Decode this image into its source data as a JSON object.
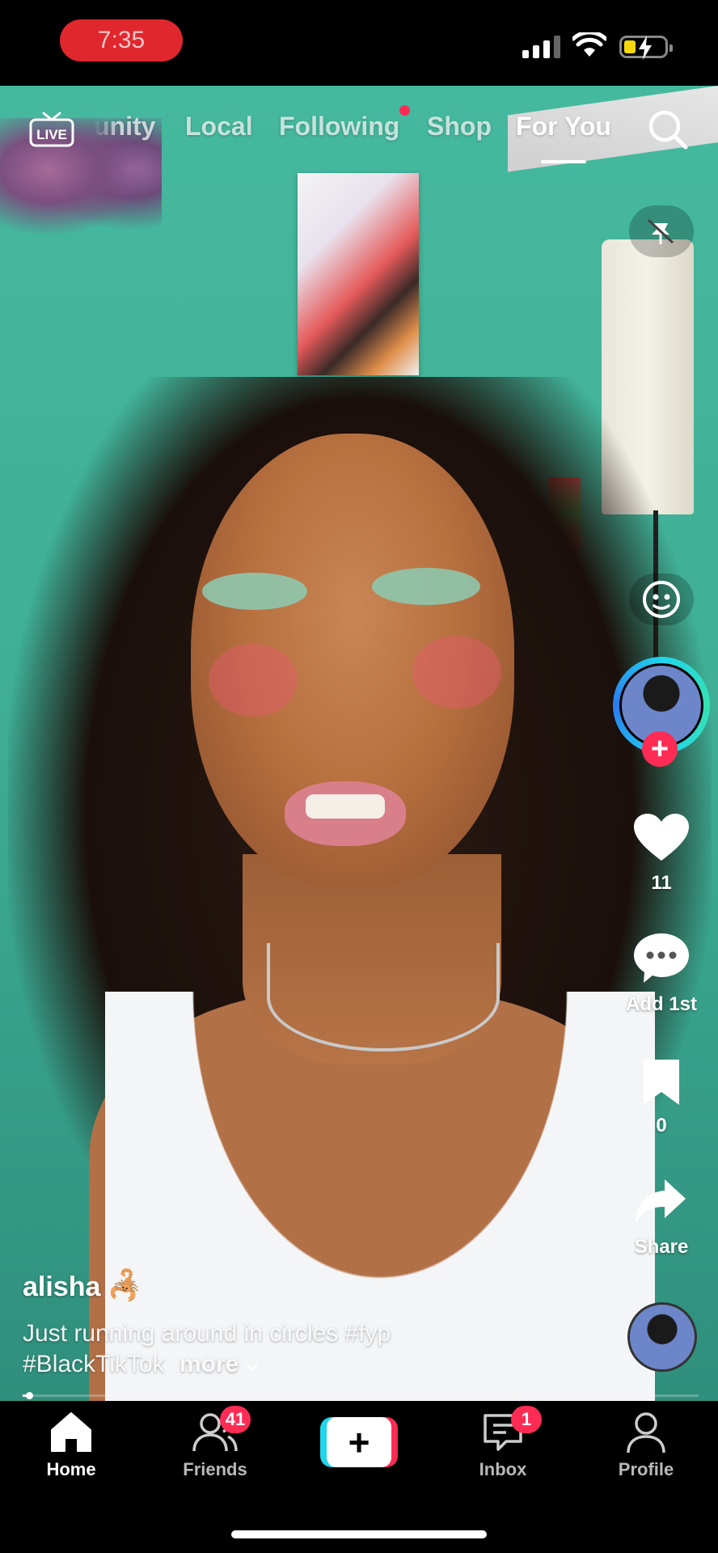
{
  "status_bar": {
    "time": "7:35"
  },
  "top_nav": {
    "live_label": "LIVE",
    "tabs": [
      {
        "label": "unity"
      },
      {
        "label": "Local"
      },
      {
        "label": "Following"
      },
      {
        "label": "Shop"
      },
      {
        "label": "For You"
      }
    ],
    "active_tab": "For You"
  },
  "right_rail": {
    "likes": "11",
    "comment_label": "Add 1st",
    "saves": "0",
    "share_label": "Share"
  },
  "post": {
    "username": "alisha",
    "emoji": "🦂",
    "caption": "Just running around in circles #fyp #BlackTikTok",
    "more_label": "more",
    "progress": 0.01
  },
  "bottom_nav": {
    "items": [
      {
        "label": "Home"
      },
      {
        "label": "Friends",
        "badge": "41"
      },
      {
        "label": "Inbox",
        "badge": "1"
      },
      {
        "label": "Profile"
      }
    ],
    "create_label": "+"
  },
  "colors": {
    "accent": "#fe2c55",
    "cyan": "#20d5ec",
    "wall": "#45b99e"
  }
}
